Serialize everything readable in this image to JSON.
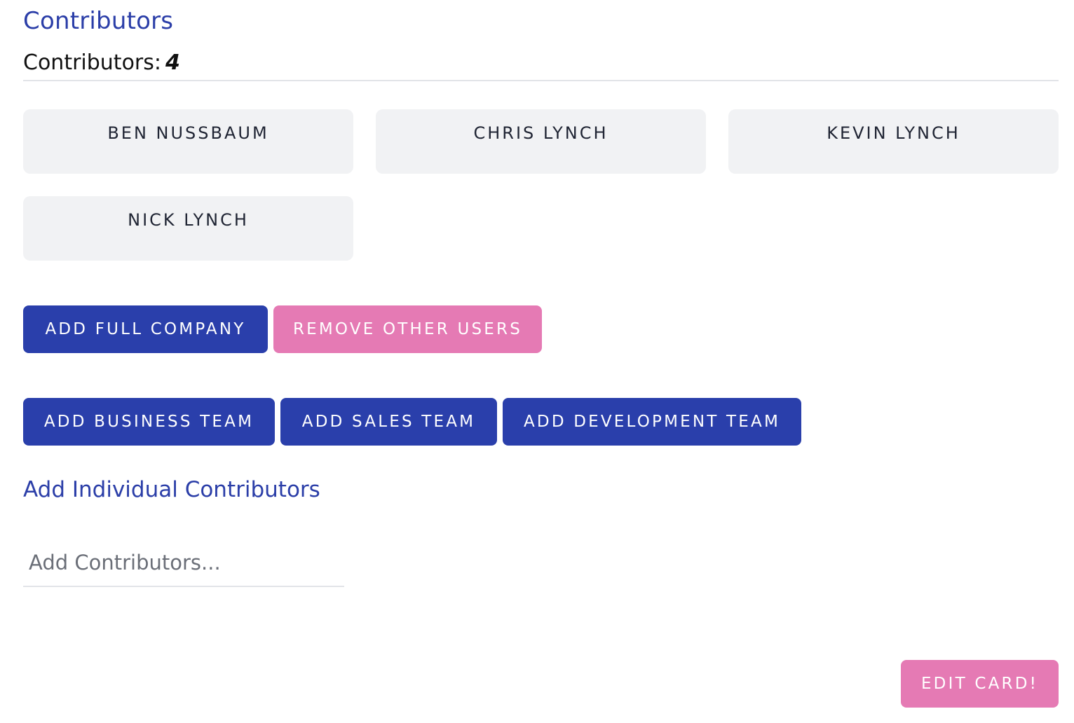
{
  "section": {
    "title": "Contributors",
    "count_label": "Contributors:",
    "count_value": "4"
  },
  "contributors": [
    {
      "name": "BEN NUSSBAUM"
    },
    {
      "name": "CHRIS LYNCH"
    },
    {
      "name": "KEVIN LYNCH"
    },
    {
      "name": "NICK LYNCH"
    }
  ],
  "actions": {
    "add_full_company": "ADD FULL COMPANY",
    "remove_other_users": "REMOVE OTHER USERS",
    "add_business_team": "ADD BUSINESS TEAM",
    "add_sales_team": "ADD SALES TEAM",
    "add_development_team": "ADD DEVELOPMENT TEAM"
  },
  "individual": {
    "title": "Add Individual Contributors",
    "placeholder": "Add Contributors...",
    "value": ""
  },
  "footer": {
    "edit_card": "EDIT CARD!"
  },
  "colors": {
    "primary": "#2a3fab",
    "accent": "#e57ab4",
    "card_bg": "#f1f2f4",
    "title": "#2b3ea8"
  }
}
